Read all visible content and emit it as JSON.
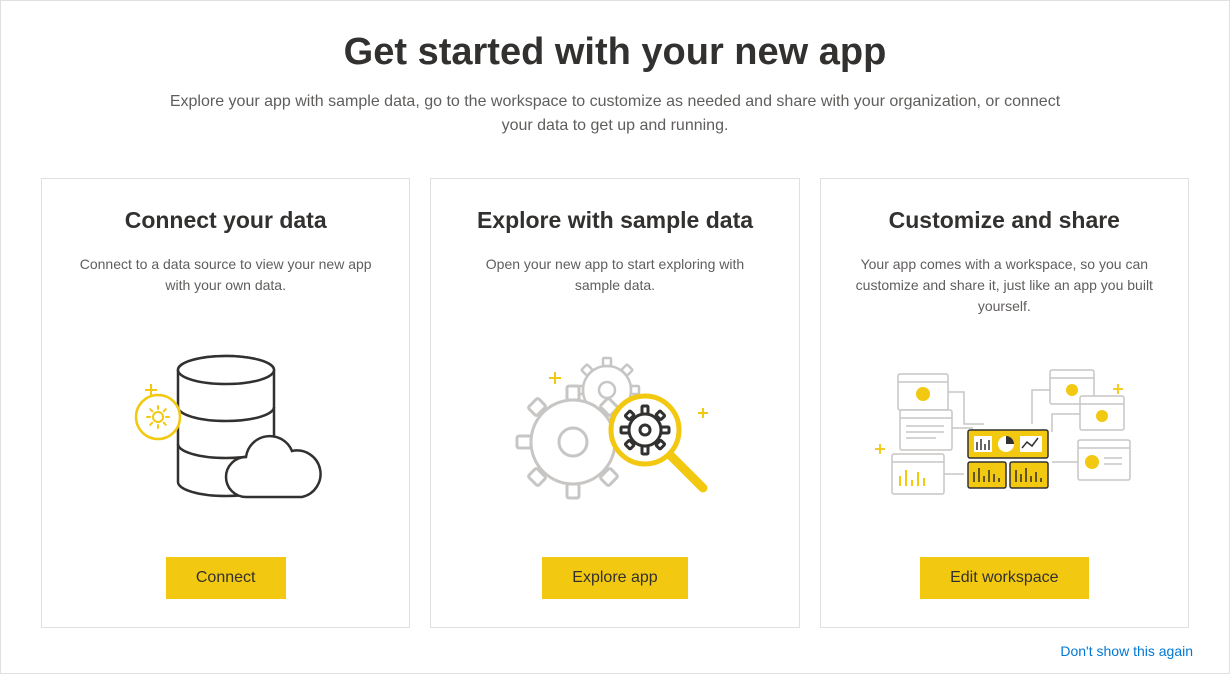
{
  "header": {
    "title": "Get started with your new app",
    "subtitle": "Explore your app with sample data, go to the workspace to customize as needed and share with your organization, or connect your data to get up and running."
  },
  "cards": [
    {
      "title": "Connect your data",
      "description": "Connect to a data source to view your new app with your own data.",
      "button_label": "Connect"
    },
    {
      "title": "Explore with sample data",
      "description": "Open your new app to start exploring with sample data.",
      "button_label": "Explore app"
    },
    {
      "title": "Customize and share",
      "description": "Your app comes with a workspace, so you can customize and share it, just like an app you built yourself.",
      "button_label": "Edit workspace"
    }
  ],
  "dismiss_label": "Don't show this again"
}
